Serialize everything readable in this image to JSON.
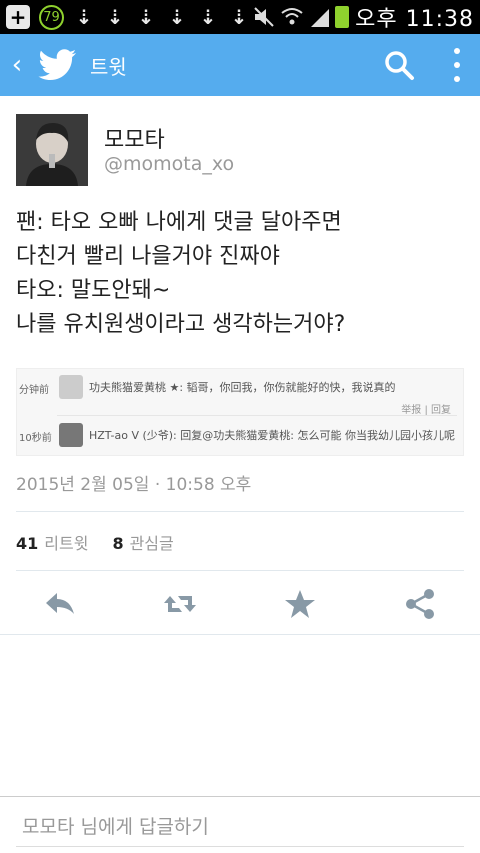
{
  "status_bar": {
    "badge": "79",
    "time": "오후 11:38"
  },
  "app_bar": {
    "title": "트윗",
    "color": "#55acee"
  },
  "tweet": {
    "name": "모모타",
    "handle": "@momota_xo",
    "lines": [
      "팬: 타오 오빠 나에게 댓글 달아주면",
      "다친거 빨리 나을거야 진짜야",
      "타오: 말도안돼~",
      "나를 유치원생이라고 생각하는거야?"
    ],
    "timestamp": "2015년 2월 05일 · 10:58 오후",
    "retweet_count": "41",
    "retweet_label": "리트윗",
    "favorite_count": "8",
    "favorite_label": "관심글"
  },
  "embed": {
    "row1_time": "分钟前",
    "row1_text": "功夫熊猫爱黄桃 ★: 韬哥，你回我，你伤就能好的快，我说真的",
    "row1_actions": "举报 | 回复",
    "row2_time": "10秒前",
    "row2_text": "HZT-ao V (少爷): 回复@功夫熊猫爱黄桃: 怎么可能 你当我幼儿园小孩儿呢"
  },
  "reply": {
    "placeholder": "모모타 님에게 답글하기"
  }
}
